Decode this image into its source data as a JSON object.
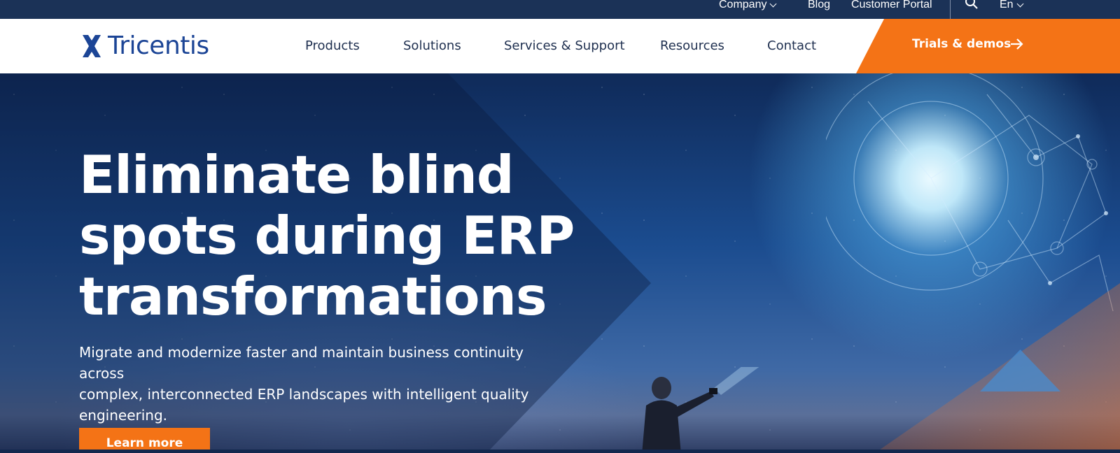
{
  "utility_bar": {
    "company": "Company",
    "blog": "Blog",
    "customer_portal": "Customer Portal",
    "language": "En"
  },
  "nav": {
    "logo_text": "Tricentis",
    "items": [
      "Products",
      "Solutions",
      "Services & Support",
      "Resources",
      "Contact"
    ],
    "cta_label": "Trials & demos"
  },
  "hero": {
    "headline_lines": [
      "Eliminate blind",
      "spots during ERP",
      "transformations"
    ],
    "subtext_lines": [
      "Migrate and modernize faster and maintain business continuity across",
      "complex, interconnected ERP landscapes with intelligent quality",
      "engineering."
    ],
    "button_label": "Learn more"
  },
  "colors": {
    "brand_navy": "#1b3257",
    "logo_blue": "#1c4596",
    "accent_orange": "#f47316"
  },
  "icons": {
    "search": "search-icon",
    "arrow": "arrow-right-icon",
    "chevron": "chevron-down-icon",
    "logo_mark": "tricentis-x-icon"
  }
}
